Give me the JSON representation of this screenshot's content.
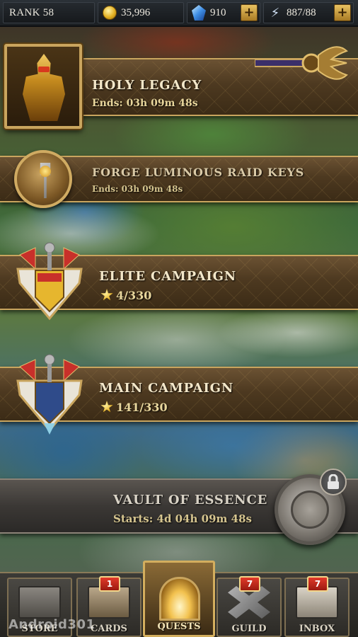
{
  "topbar": {
    "rank": "RANK 58",
    "gold": "35,996",
    "gems": "910",
    "energy": "887/88",
    "plus": "+"
  },
  "events": {
    "holy_legacy": {
      "title": "HOLY LEGACY",
      "subtitle": "Ends: 03h 09m 48s"
    },
    "forge": {
      "title": "FORGE LUMINOUS RAID KEYS",
      "subtitle": "Ends: 03h 09m 48s"
    },
    "elite": {
      "title": "ELITE CAMPAIGN",
      "progress": "4/330"
    },
    "main": {
      "title": "MAIN CAMPAIGN",
      "progress": "141/330"
    },
    "vault": {
      "title": "VAULT OF ESSENCE",
      "subtitle": "Starts: 4d 04h 09m 48s"
    }
  },
  "nav": {
    "store": {
      "label": "STORE"
    },
    "cards": {
      "label": "CARDS",
      "badge": "1"
    },
    "quests": {
      "label": "QUESTS"
    },
    "guild": {
      "label": "GUILD",
      "badge": "7"
    },
    "inbox": {
      "label": "INBOX",
      "badge": "7"
    }
  },
  "watermark": "Android301",
  "colors": {
    "banner_gold": "#c9a55e",
    "badge_red": "#e23a2a",
    "vault_grey": "#5a5550"
  }
}
